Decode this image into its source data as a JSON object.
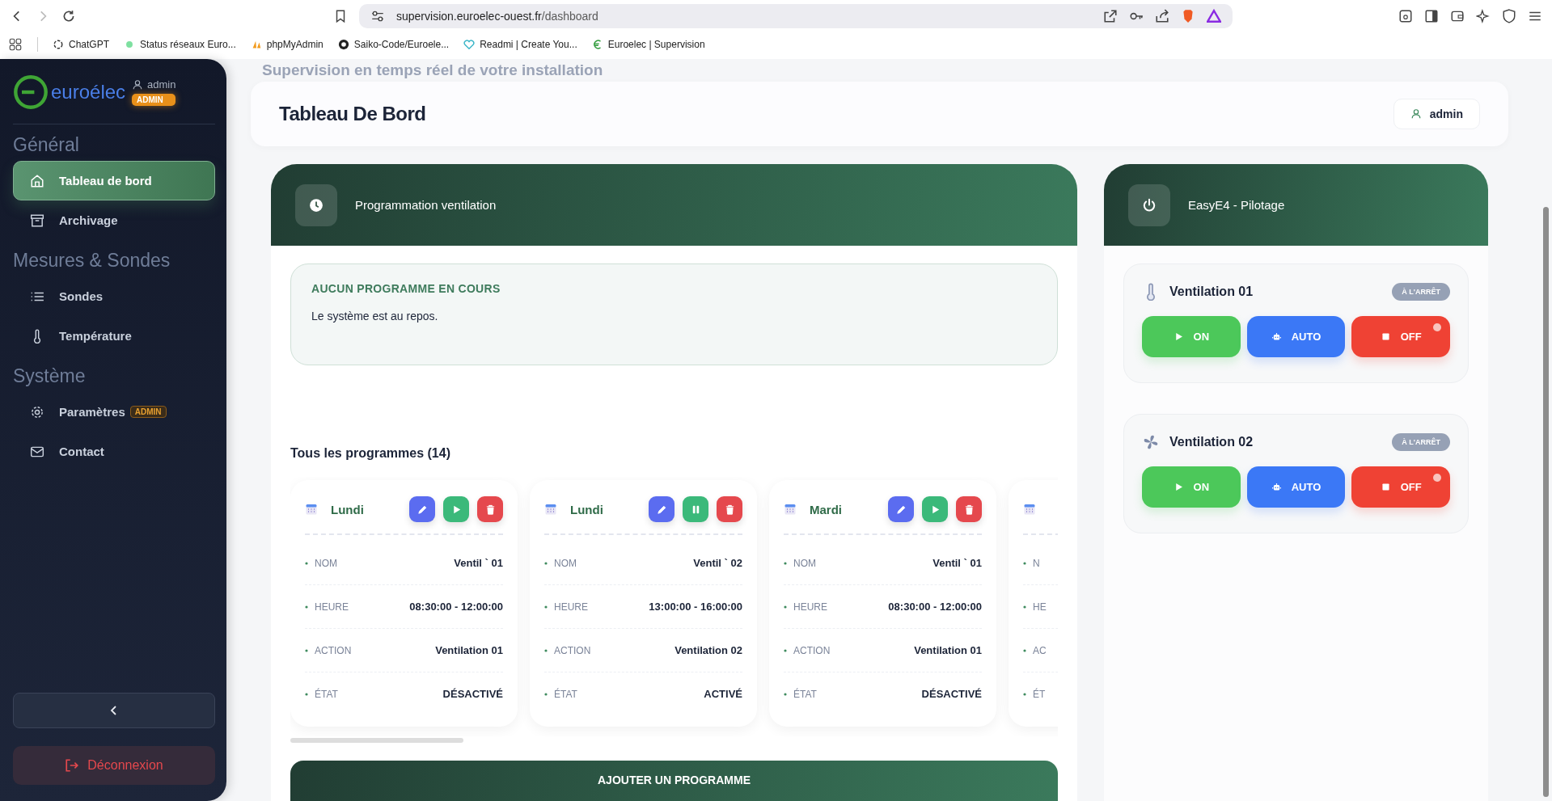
{
  "browser": {
    "url_host": "supervision.euroelec-ouest.fr",
    "url_path": "/dashboard",
    "bookmarks": [
      {
        "label": "ChatGPT"
      },
      {
        "label": "Status réseaux Euro..."
      },
      {
        "label": "phpMyAdmin"
      },
      {
        "label": "Saiko-Code/Euroele..."
      },
      {
        "label": "Readmi | Create You..."
      },
      {
        "label": "Euroelec | Supervision"
      }
    ]
  },
  "sidebar": {
    "logo": "euroélec",
    "user": "admin",
    "role_badge": "ADMIN",
    "sections": [
      {
        "title": "Général",
        "items": [
          {
            "label": "Tableau de bord",
            "selected": true
          },
          {
            "label": "Archivage",
            "selected": false
          }
        ]
      },
      {
        "title": "Mesures & Sondes",
        "items": [
          {
            "label": "Sondes",
            "selected": false
          },
          {
            "label": "Température",
            "selected": false
          }
        ]
      },
      {
        "title": "Système",
        "items": [
          {
            "label": "Paramètres",
            "selected": false,
            "badge": "ADMIN"
          },
          {
            "label": "Contact",
            "selected": false
          }
        ]
      }
    ],
    "logout": "Déconnexion"
  },
  "subtitle": "Supervision en temps réel de votre installation",
  "header": {
    "title": "Tableau De Bord",
    "user": "admin"
  },
  "schedule": {
    "title": "Programmation ventilation",
    "status": {
      "heading": "AUCUN PROGRAMME EN COURS",
      "text": "Le système est au repos."
    },
    "list_title": "Tous les programmes (14)",
    "programs": [
      {
        "day": "Lundi",
        "actions": [
          {
            "kind": "edit"
          },
          {
            "kind": "play"
          },
          {
            "kind": "delete"
          }
        ],
        "fields": [
          {
            "label": "NOM",
            "value": "Ventil ` 01"
          },
          {
            "label": "HEURE",
            "value": "08:30:00 - 12:00:00"
          },
          {
            "label": "ACTION",
            "value": "Ventilation 01"
          },
          {
            "label": "ÉTAT",
            "value": "DÉSACTIVÉ"
          }
        ]
      },
      {
        "day": "Lundi",
        "actions": [
          {
            "kind": "edit"
          },
          {
            "kind": "pause"
          },
          {
            "kind": "delete"
          }
        ],
        "fields": [
          {
            "label": "NOM",
            "value": "Ventil ` 02"
          },
          {
            "label": "HEURE",
            "value": "13:00:00 - 16:00:00"
          },
          {
            "label": "ACTION",
            "value": "Ventilation 02"
          },
          {
            "label": "ÉTAT",
            "value": "ACTIVÉ"
          }
        ]
      },
      {
        "day": "Mardi",
        "actions": [
          {
            "kind": "edit"
          },
          {
            "kind": "play"
          },
          {
            "kind": "delete"
          }
        ],
        "fields": [
          {
            "label": "NOM",
            "value": "Ventil ` 01"
          },
          {
            "label": "HEURE",
            "value": "08:30:00 - 12:00:00"
          },
          {
            "label": "ACTION",
            "value": "Ventilation 01"
          },
          {
            "label": "ÉTAT",
            "value": "DÉSACTIVÉ"
          }
        ]
      },
      {
        "fields": [
          {
            "label": "N"
          },
          {
            "label": "HE"
          },
          {
            "label": "AC"
          },
          {
            "label": "ÉT"
          }
        ]
      }
    ],
    "add_button": "AJOUTER UN PROGRAMME"
  },
  "control": {
    "title": "EasyE4 - Pilotage",
    "devices": [
      {
        "name": "Ventilation 01",
        "status": "À L'ARRÊT",
        "buttons": [
          {
            "label": "ON",
            "kind": "on",
            "selected": false
          },
          {
            "label": "AUTO",
            "kind": "auto",
            "selected": false
          },
          {
            "label": "OFF",
            "kind": "off",
            "selected": true
          }
        ]
      },
      {
        "name": "Ventilation 02",
        "status": "À L'ARRÊT",
        "buttons": [
          {
            "label": "ON",
            "kind": "on",
            "selected": false
          },
          {
            "label": "AUTO",
            "kind": "auto",
            "selected": false
          },
          {
            "label": "OFF",
            "kind": "off",
            "selected": true
          }
        ]
      }
    ]
  }
}
